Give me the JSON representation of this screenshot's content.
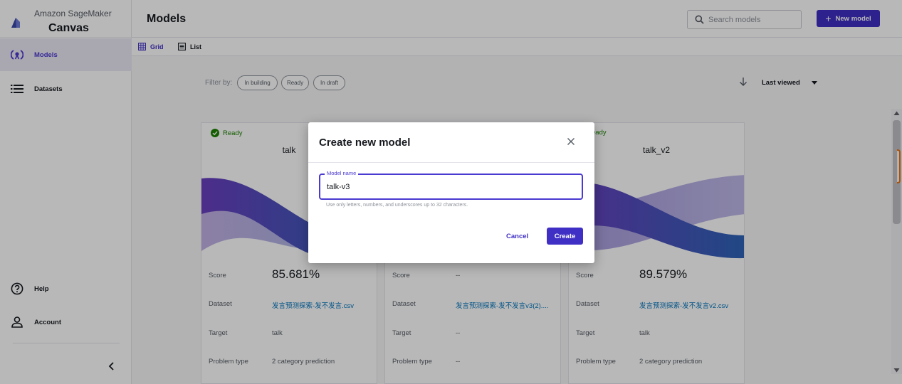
{
  "brand": {
    "subtitle": "Amazon SageMaker",
    "title": "Canvas"
  },
  "sidebar": {
    "items": [
      {
        "label": "Models",
        "icon": "models-icon",
        "active": true
      },
      {
        "label": "Datasets",
        "icon": "list-icon",
        "active": false
      }
    ],
    "bottom_items": [
      {
        "label": "Help",
        "icon": "help-icon"
      },
      {
        "label": "Account",
        "icon": "user-icon"
      }
    ]
  },
  "header": {
    "title": "Models",
    "search_placeholder": "Search models",
    "new_button": "New model"
  },
  "view_toggle": {
    "grid_label": "Grid",
    "list_label": "List",
    "selected": "Grid"
  },
  "filters": {
    "label": "Filter by:",
    "chips": [
      "In building",
      "Ready",
      "In draft"
    ],
    "sort_label": "Last viewed"
  },
  "field_labels": {
    "score": "Score",
    "dataset": "Dataset",
    "target": "Target",
    "problem_type": "Problem type"
  },
  "cards": [
    {
      "status": "Ready",
      "title": "talk",
      "score": "85.681%",
      "dataset": "发言预测探索-发不发言.csv",
      "target": "talk",
      "problem_type": "2 category prediction"
    },
    {
      "status": "",
      "title": "",
      "score": "--",
      "dataset": "发言预测探索-发不发言v3(2)....",
      "target": "--",
      "problem_type": "--"
    },
    {
      "status": "eady",
      "title": "talk_v2",
      "score": "89.579%",
      "dataset": "发言预测探索-发不发言v2.csv",
      "target": "talk",
      "problem_type": "2 category prediction"
    }
  ],
  "modal": {
    "title": "Create new model",
    "field_label": "Model name",
    "field_value": "talk-v3",
    "hint": "Use only letters, numbers, and underscores up to 32 characters.",
    "cancel_label": "Cancel",
    "create_label": "Create"
  },
  "colors": {
    "accent": "#3f2fc4",
    "ready": "#1d8102",
    "link": "#0073bb",
    "scroll_accent": "#ec7211"
  }
}
